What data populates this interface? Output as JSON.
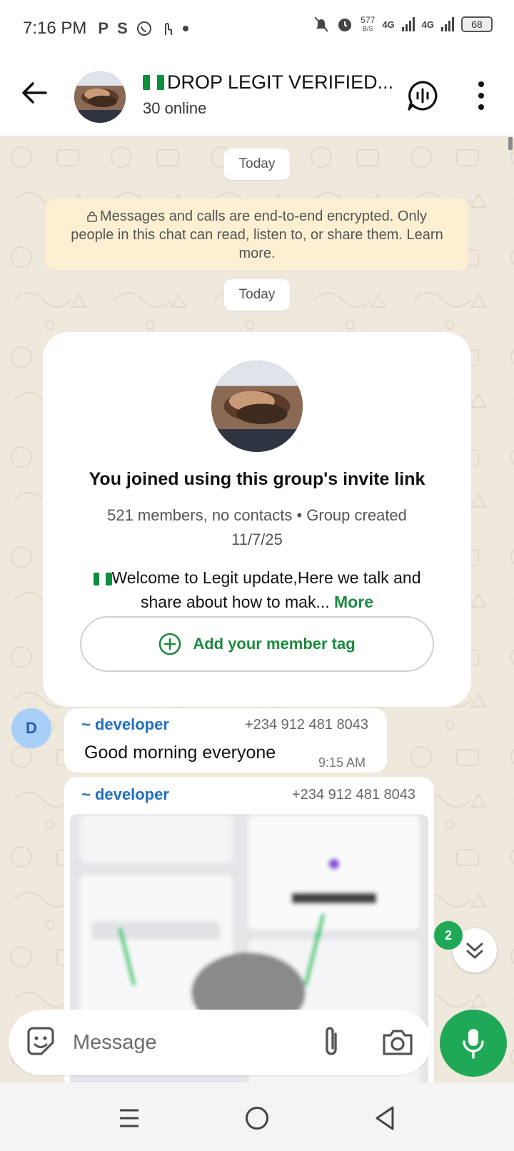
{
  "status_bar": {
    "time": "7:16 PM",
    "apps": [
      "P",
      "S"
    ],
    "speed_value": "577",
    "speed_unit": "B/S",
    "net1": "4G",
    "net2": "4G",
    "battery": "68"
  },
  "header": {
    "title": "DROP LEGIT VERIFIED...",
    "subtitle": "30 online"
  },
  "chat": {
    "date_chip_1": "Today",
    "encryption_notice": "Messages and calls are end-to-end encrypted. Only people in this chat can read, listen to, or share them. Learn more.",
    "date_chip_2": "Today",
    "group_card": {
      "title": "You joined using this group's invite link",
      "meta": "521 members, no contacts • Group created 11/7/25",
      "description": "Welcome to Legit update,Here we talk and share about how to mak...",
      "more_label": "More",
      "member_tag_label": "Add your member tag"
    },
    "messages": [
      {
        "avatar_letter": "D",
        "sender": "~ developer",
        "phone": "+234 912 481 8043",
        "text": "Good morning everyone",
        "time": "9:15 AM"
      },
      {
        "sender": "~ developer",
        "phone": "+234 912 481 8043"
      }
    ],
    "unread_count": "2"
  },
  "composer": {
    "placeholder": "Message"
  },
  "colors": {
    "accent": "#1fa855",
    "chat_bg": "#efe8dc",
    "notice_bg": "#fcefd2",
    "sender_name": "#1f6fbf"
  }
}
